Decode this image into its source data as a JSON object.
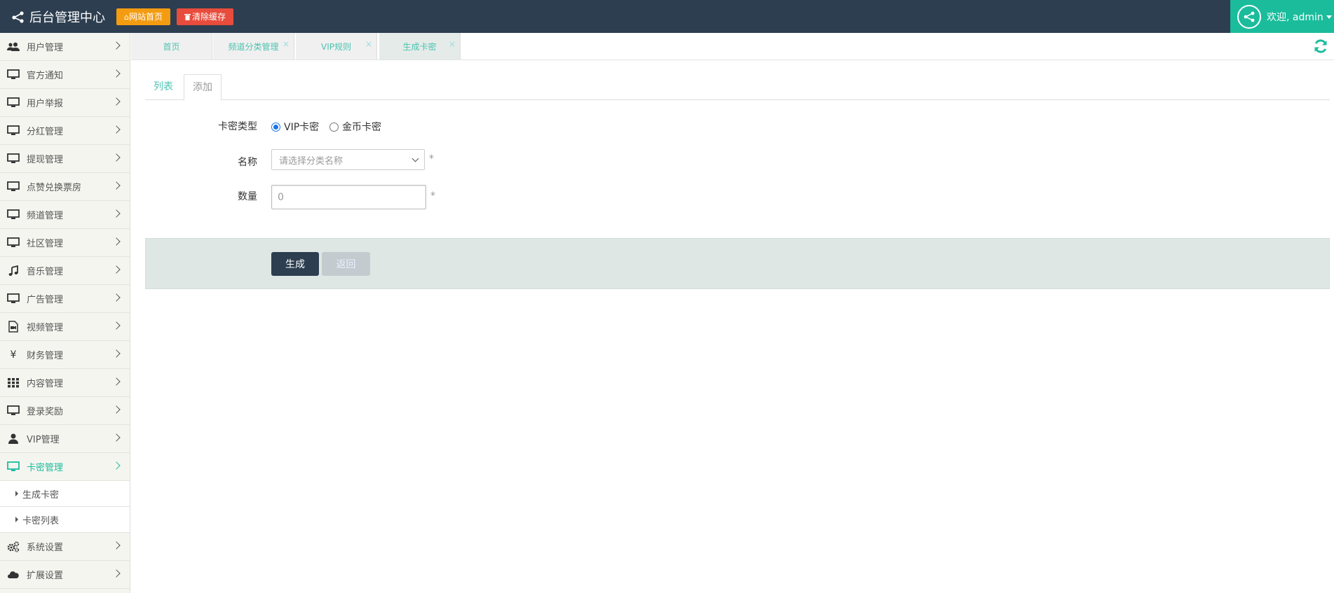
{
  "header": {
    "brand": "后台管理中心",
    "home_button": "网站首页",
    "clear_cache_button": "清除缓存",
    "welcome": "欢迎, admin",
    "colors": {
      "bar": "#2d3e50",
      "home": "#f39c12",
      "cache": "#e74c3c",
      "user": "#1abc9c"
    }
  },
  "sidebar": {
    "items": [
      {
        "label": "用户管理",
        "icon": "users-icon"
      },
      {
        "label": "官方通知",
        "icon": "monitor-icon"
      },
      {
        "label": "用户举报",
        "icon": "monitor-icon"
      },
      {
        "label": "分红管理",
        "icon": "monitor-icon"
      },
      {
        "label": "提现管理",
        "icon": "monitor-icon"
      },
      {
        "label": "点赞兑换票房",
        "icon": "monitor-icon"
      },
      {
        "label": "频道管理",
        "icon": "monitor-icon"
      },
      {
        "label": "社区管理",
        "icon": "monitor-icon"
      },
      {
        "label": "音乐管理",
        "icon": "music-icon"
      },
      {
        "label": "广告管理",
        "icon": "monitor-icon"
      },
      {
        "label": "视频管理",
        "icon": "video-file-icon"
      },
      {
        "label": "财务管理",
        "icon": "yen-icon"
      },
      {
        "label": "内容管理",
        "icon": "grid-icon"
      },
      {
        "label": "登录奖励",
        "icon": "monitor-icon"
      },
      {
        "label": "VIP管理",
        "icon": "user-icon"
      },
      {
        "label": "卡密管理",
        "icon": "monitor-icon"
      },
      {
        "label": "系统设置",
        "icon": "gears-icon"
      },
      {
        "label": "扩展设置",
        "icon": "cloud-icon"
      }
    ],
    "sub_items": [
      "生成卡密",
      "卡密列表"
    ],
    "active_color": "#1abc9c"
  },
  "tabs": [
    {
      "label": "首页",
      "closable": false
    },
    {
      "label": "频道分类管理",
      "closable": true
    },
    {
      "label": "VIP规则",
      "closable": true
    },
    {
      "label": "生成卡密",
      "closable": true
    }
  ],
  "content": {
    "tabs": [
      "列表",
      "添加"
    ],
    "form": {
      "type_label": "卡密类型",
      "type_options": [
        "VIP卡密",
        "金币卡密"
      ],
      "type_selected": "VIP卡密",
      "name_label": "名称",
      "name_placeholder": "请选择分类名称",
      "qty_label": "数量",
      "qty_value": "0",
      "required_mark": "*"
    },
    "generate_button": "生成",
    "back_button": "返回"
  }
}
